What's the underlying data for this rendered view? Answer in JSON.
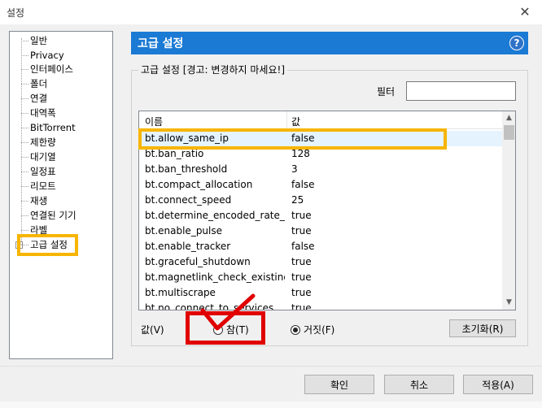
{
  "window": {
    "title": "설정",
    "close_glyph": "✕"
  },
  "sidebar": {
    "items": [
      {
        "label": "일반"
      },
      {
        "label": "Privacy"
      },
      {
        "label": "인터페이스"
      },
      {
        "label": "폴더"
      },
      {
        "label": "연결"
      },
      {
        "label": "대역폭"
      },
      {
        "label": "BitTorrent"
      },
      {
        "label": "제한량"
      },
      {
        "label": "대기열"
      },
      {
        "label": "일정표"
      },
      {
        "label": "리모트"
      },
      {
        "label": "재생"
      },
      {
        "label": "연결된 기기"
      },
      {
        "label": "라벨"
      },
      {
        "label": "고급 설정",
        "selected": true,
        "expander": "+"
      }
    ]
  },
  "panel": {
    "title": "고급 설정",
    "help": "?",
    "group_label": "고급 설정 [경고: 변경하지 마세요!]",
    "filter": {
      "label": "필터",
      "value": ""
    },
    "table": {
      "columns": [
        "이름",
        "값"
      ],
      "rows": [
        {
          "name": "bt.allow_same_ip",
          "value": "false"
        },
        {
          "name": "bt.ban_ratio",
          "value": "128"
        },
        {
          "name": "bt.ban_threshold",
          "value": "3"
        },
        {
          "name": "bt.compact_allocation",
          "value": "false"
        },
        {
          "name": "bt.connect_speed",
          "value": "25"
        },
        {
          "name": "bt.determine_encoded_rate_fo...",
          "value": "true"
        },
        {
          "name": "bt.enable_pulse",
          "value": "true"
        },
        {
          "name": "bt.enable_tracker",
          "value": "false"
        },
        {
          "name": "bt.graceful_shutdown",
          "value": "true"
        },
        {
          "name": "bt.magnetlink_check_existing_...",
          "value": "true"
        },
        {
          "name": "bt.multiscrape",
          "value": "true"
        },
        {
          "name": "bt.no_connect_to_services",
          "value": "true"
        }
      ],
      "selected_index": 0
    },
    "value_label": "값(V)",
    "radio_true": "참(T)",
    "radio_false": "거짓(F)",
    "selected_radio": "false",
    "reset_label": "초기화(R)"
  },
  "footer": {
    "ok": "확인",
    "cancel": "취소",
    "apply": "적용(A)"
  },
  "colors": {
    "header_blue": "#1b7ad4",
    "highlight_yellow": "#f7b500",
    "highlight_red": "#e00000"
  },
  "icons": {
    "help": "question-icon",
    "close": "close-icon",
    "expander": "plus-box-icon",
    "check": "check-mark-icon"
  }
}
